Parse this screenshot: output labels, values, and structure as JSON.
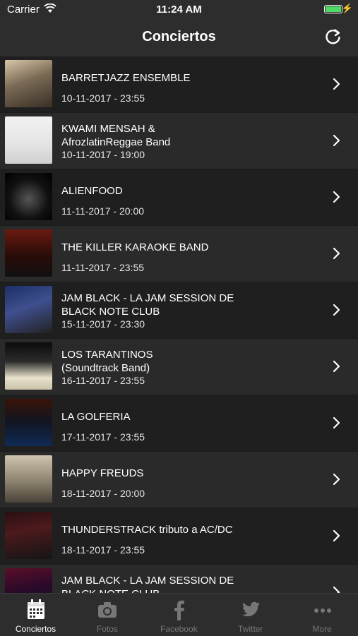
{
  "status": {
    "carrier": "Carrier",
    "time": "11:24 AM"
  },
  "nav": {
    "title": "Conciertos"
  },
  "events": [
    {
      "title": "BARRETJAZZ ENSEMBLE",
      "date": "10-11-2017 - 23:55"
    },
    {
      "title": "KWAMI MENSAH &\nAfrozlatinReggae Band",
      "date": "10-11-2017 - 19:00"
    },
    {
      "title": "ALIENFOOD",
      "date": "11-11-2017 - 20:00"
    },
    {
      "title": "THE KILLER KARAOKE BAND",
      "date": "11-11-2017 - 23:55"
    },
    {
      "title": "JAM BLACK - LA JAM SESSION DE\nBLACK NOTE CLUB",
      "date": "15-11-2017 - 23:30"
    },
    {
      "title": "LOS TARANTINOS\n(Soundtrack Band)",
      "date": "16-11-2017 - 23:55"
    },
    {
      "title": "LA GOLFERIA",
      "date": "17-11-2017 - 23:55"
    },
    {
      "title": "HAPPY FREUDS",
      "date": "18-11-2017 - 20:00"
    },
    {
      "title": "THUNDERSTRACK tributo a AC/DC",
      "date": "18-11-2017 - 23:55"
    },
    {
      "title": "JAM BLACK - LA JAM SESSION DE\nBLACK NOTE CLUB",
      "date": ""
    }
  ],
  "tabs": [
    {
      "label": "Conciertos",
      "icon": "calendar-icon"
    },
    {
      "label": "Fotos",
      "icon": "camera-icon"
    },
    {
      "label": "Facebook",
      "icon": "facebook-icon"
    },
    {
      "label": "Twitter",
      "icon": "twitter-icon"
    },
    {
      "label": "More",
      "icon": "more-icon"
    }
  ],
  "colors": {
    "accent": "#4cd964",
    "background": "#262626",
    "bar": "#2d2d2d"
  }
}
